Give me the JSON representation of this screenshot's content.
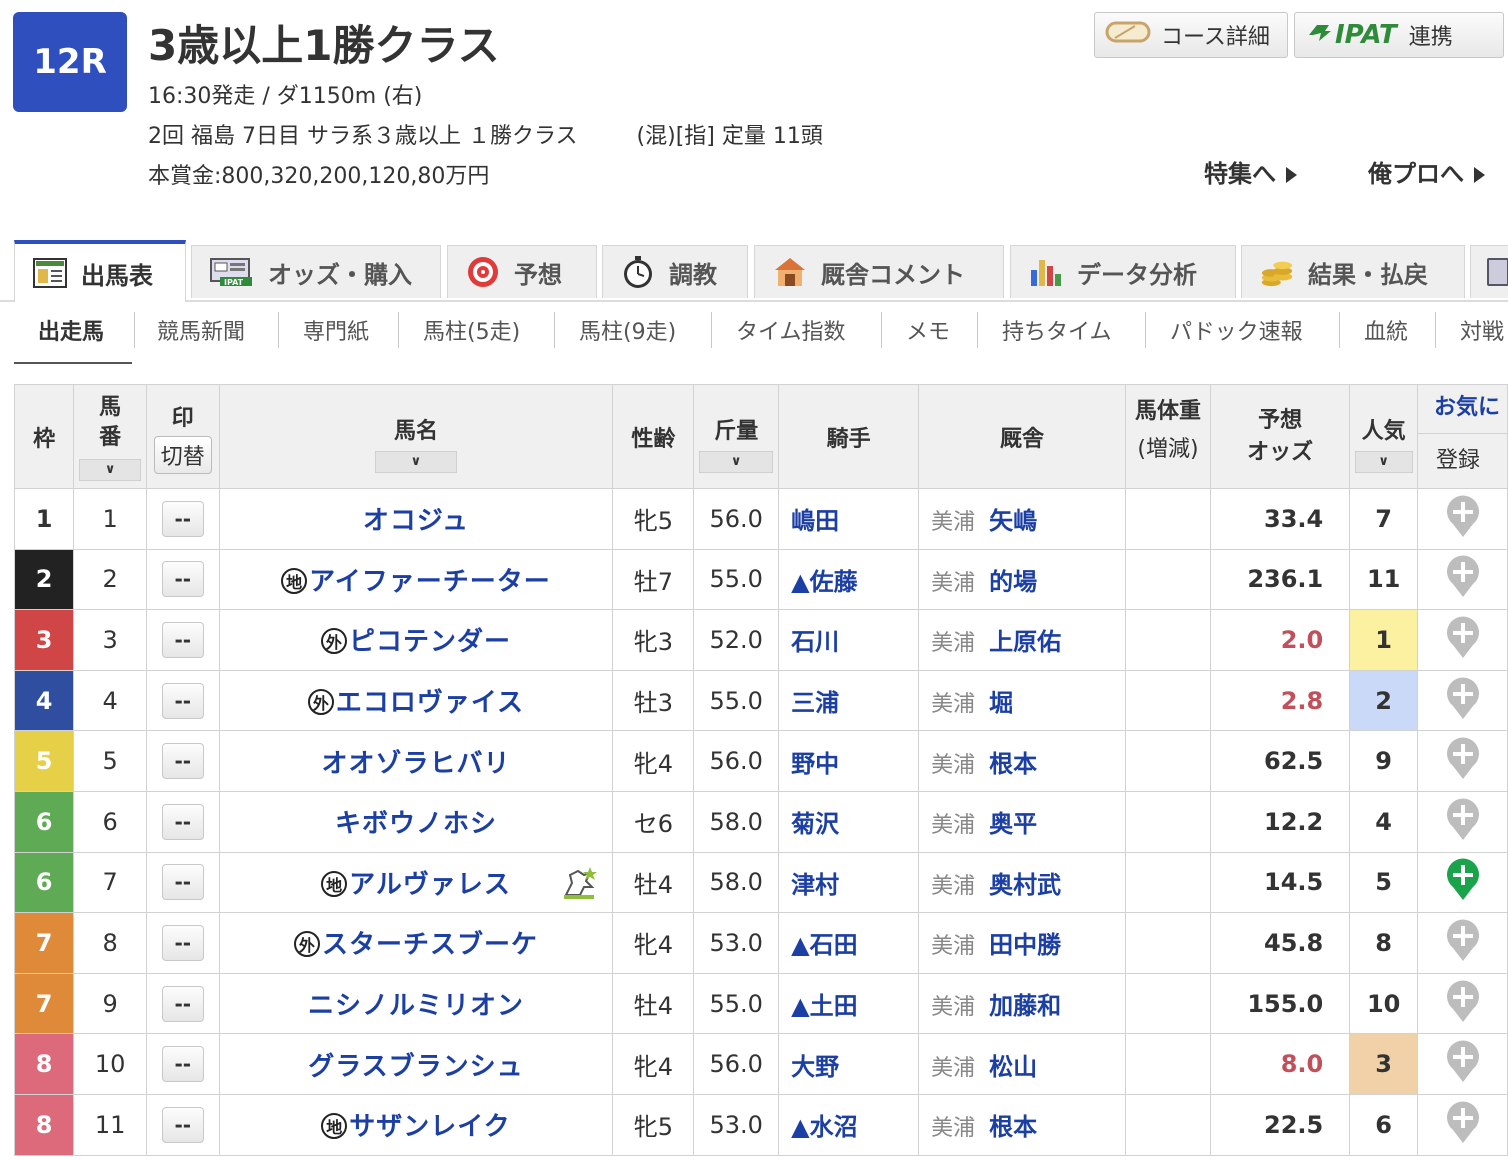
{
  "race": {
    "number": "12R",
    "title": "3歳以上1勝クラス",
    "start_info": "16:30発走 / ダ1150m (右)",
    "condition_left": "2回 福島 7日目 サラ系３歳以上 １勝クラス",
    "condition_right": "(混)[指] 定量 11頭",
    "prize": "本賞金:800,320,200,120,80万円"
  },
  "top_buttons": {
    "course": "コース詳細",
    "ipat_logo": "IPAT",
    "ipat": "連携"
  },
  "links": {
    "feature": "特集へ",
    "orepro": "俺プロへ"
  },
  "tabs": [
    {
      "label": "出馬表",
      "icon": "table-icon"
    },
    {
      "label": "オッズ・購入",
      "icon": "ipat-icon"
    },
    {
      "label": "予想",
      "icon": "target-icon"
    },
    {
      "label": "調教",
      "icon": "stopwatch-icon"
    },
    {
      "label": "厩舎コメント",
      "icon": "stable-icon"
    },
    {
      "label": "データ分析",
      "icon": "bar-chart-icon"
    },
    {
      "label": "結果・払戻",
      "icon": "coins-icon"
    }
  ],
  "subtabs": [
    "出走馬",
    "競馬新聞",
    "専門紙",
    "馬柱(5走)",
    "馬柱(9走)",
    "タイム指数",
    "メモ",
    "持ちタイム",
    "パドック速報",
    "血統",
    "対戦"
  ],
  "table": {
    "headers": {
      "waku": "枠",
      "umaban": "馬\n番",
      "mark": "印",
      "mark_switch": "切替",
      "name": "馬名",
      "sexage": "性齢",
      "weight": "斤量",
      "jockey": "騎手",
      "trainer": "厩舎",
      "body": "馬体重",
      "body_sub": "(増減)",
      "odds": "予想\nオッズ",
      "pop": "人気",
      "fav": "お気に",
      "fav_sub": "登録",
      "sort_glyph": "∨"
    },
    "mark_placeholder": "--",
    "jichi_label": "地",
    "gai_label": "外",
    "rows": [
      {
        "waku": "1",
        "umaban": "1",
        "tag": "",
        "name": "オコジュ",
        "sexage": "牝5",
        "weight": "56.0",
        "jockey": "嶋田",
        "area": "美浦",
        "trainer": "矢嶋",
        "odds": "33.4",
        "pop": "7",
        "fav_added": false
      },
      {
        "waku": "2",
        "umaban": "2",
        "tag": "地",
        "name": "アイファーチーター",
        "sexage": "牡7",
        "weight": "55.0",
        "jockey": "▲佐藤",
        "area": "美浦",
        "trainer": "的場",
        "odds": "236.1",
        "pop": "11",
        "fav_added": false
      },
      {
        "waku": "3",
        "umaban": "3",
        "tag": "外",
        "name": "ピコテンダー",
        "sexage": "牝3",
        "weight": "52.0",
        "jockey": "石川",
        "area": "美浦",
        "trainer": "上原佑",
        "odds": "2.0",
        "pop": "1",
        "fav_added": false
      },
      {
        "waku": "4",
        "umaban": "4",
        "tag": "外",
        "name": "エコロヴァイス",
        "sexage": "牡3",
        "weight": "55.0",
        "jockey": "三浦",
        "area": "美浦",
        "trainer": "堀",
        "odds": "2.8",
        "pop": "2",
        "fav_added": false
      },
      {
        "waku": "5",
        "umaban": "5",
        "tag": "",
        "name": "オオゾラヒバリ",
        "sexage": "牝4",
        "weight": "56.0",
        "jockey": "野中",
        "area": "美浦",
        "trainer": "根本",
        "odds": "62.5",
        "pop": "9",
        "fav_added": false
      },
      {
        "waku": "6",
        "umaban": "6",
        "tag": "",
        "name": "キボウノホシ",
        "sexage": "セ6",
        "weight": "58.0",
        "jockey": "菊沢",
        "area": "美浦",
        "trainer": "奥平",
        "odds": "12.2",
        "pop": "4",
        "fav_added": false
      },
      {
        "waku": "6",
        "umaban": "7",
        "tag": "地",
        "name": "アルヴァレス",
        "sexage": "牡4",
        "weight": "58.0",
        "jockey": "津村",
        "area": "美浦",
        "trainer": "奥村武",
        "odds": "14.5",
        "pop": "5",
        "fav_added": true
      },
      {
        "waku": "7",
        "umaban": "8",
        "tag": "外",
        "name": "スターチスブーケ",
        "sexage": "牝4",
        "weight": "53.0",
        "jockey": "▲石田",
        "area": "美浦",
        "trainer": "田中勝",
        "odds": "45.8",
        "pop": "8",
        "fav_added": false
      },
      {
        "waku": "7",
        "umaban": "9",
        "tag": "",
        "name": "ニシノルミリオン",
        "sexage": "牡4",
        "weight": "55.0",
        "jockey": "▲土田",
        "area": "美浦",
        "trainer": "加藤和",
        "odds": "155.0",
        "pop": "10",
        "fav_added": false
      },
      {
        "waku": "8",
        "umaban": "10",
        "tag": "",
        "name": "グラスブランシュ",
        "sexage": "牝4",
        "weight": "56.0",
        "jockey": "大野",
        "area": "美浦",
        "trainer": "松山",
        "odds": "8.0",
        "pop": "3",
        "fav_added": false
      },
      {
        "waku": "8",
        "umaban": "11",
        "tag": "地",
        "name": "サザンレイク",
        "sexage": "牝5",
        "weight": "53.0",
        "jockey": "▲水沼",
        "area": "美浦",
        "trainer": "根本",
        "odds": "22.5",
        "pop": "6",
        "fav_added": false
      }
    ]
  },
  "colors": {
    "accent": "#2f4fbf",
    "horse_link": "#1c3fa3",
    "odds_fav": "#c0505a",
    "fav_active": "#1aa34a",
    "fav_inactive": "#bdbdbd",
    "pop_1": "#fbf1a0",
    "pop_2": "#c9d9f7",
    "pop_3": "#f1d1a8",
    "waku": {
      "1": "#ffffff",
      "2": "#222222",
      "3": "#d04545",
      "4": "#2f4ea0",
      "5": "#e6d048",
      "6": "#5faa55",
      "7": "#de8a38",
      "8": "#dc6a7a"
    }
  }
}
